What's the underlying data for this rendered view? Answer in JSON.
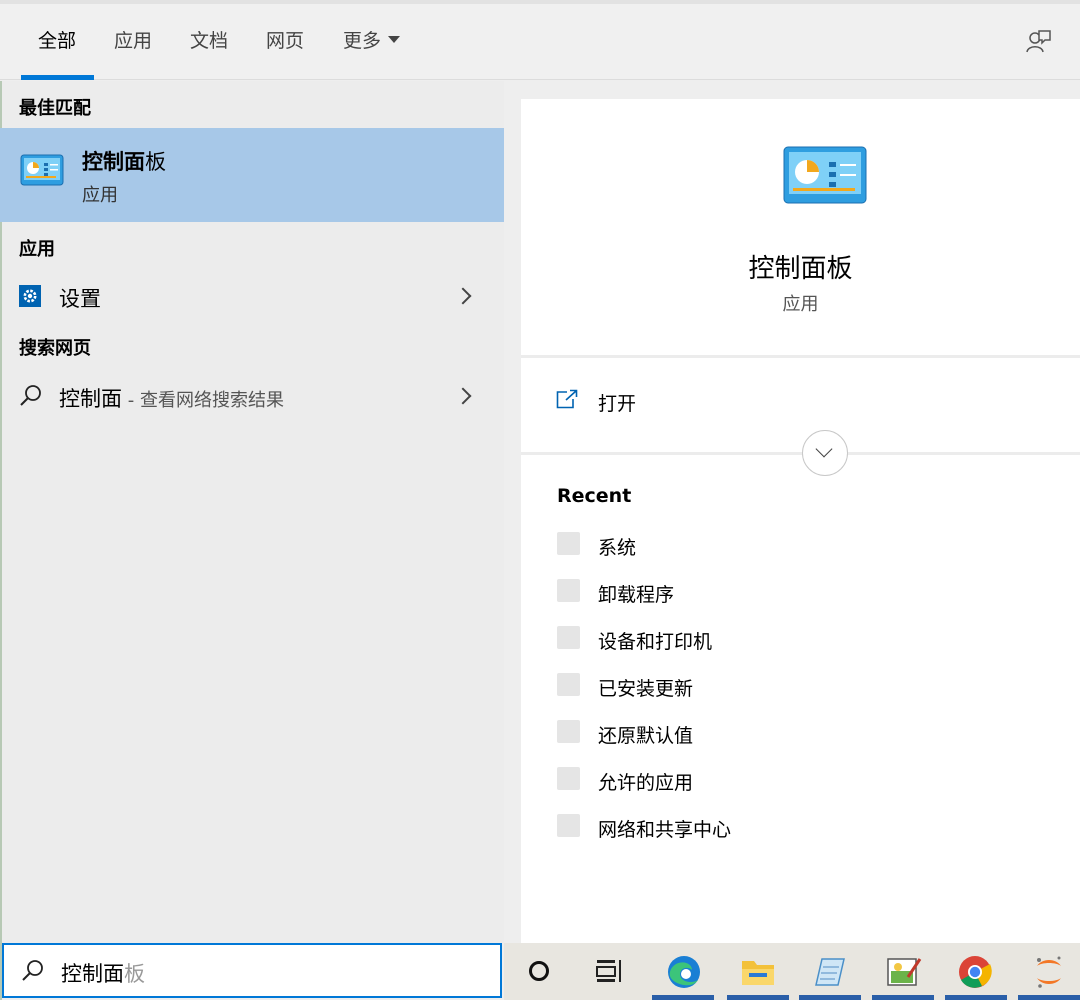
{
  "tabs": [
    {
      "label": "全部",
      "active": true
    },
    {
      "label": "应用"
    },
    {
      "label": "文档"
    },
    {
      "label": "网页"
    },
    {
      "label": "更多"
    }
  ],
  "best_match": {
    "section": "最佳匹配",
    "title_bold": "控制面",
    "title_rest": "板",
    "subtitle": "应用"
  },
  "apps": {
    "section": "应用",
    "items": [
      {
        "label": "设置",
        "icon": "gear-icon"
      }
    ]
  },
  "web": {
    "section": "搜索网页",
    "items": [
      {
        "query": "控制面",
        "suffix": " - 查看网络搜索结果",
        "icon": "search-icon"
      }
    ]
  },
  "preview": {
    "title": "控制面板",
    "subtitle": "应用",
    "open_label": "打开",
    "recent_heading": "Recent",
    "recent": [
      "系统",
      "卸载程序",
      "设备和打印机",
      "已安装更新",
      "还原默认值",
      "允许的应用",
      "网络和共享中心"
    ]
  },
  "search": {
    "typed": "控制面",
    "completion": "板"
  },
  "colors": {
    "accent": "#0078d7",
    "selection": "#a7c8e8"
  },
  "taskbar": [
    "cortana-icon",
    "task-view-icon",
    "edge-icon",
    "file-explorer-icon",
    "notepad-icon",
    "paint-icon",
    "chrome-icon",
    "jupyter-icon"
  ]
}
